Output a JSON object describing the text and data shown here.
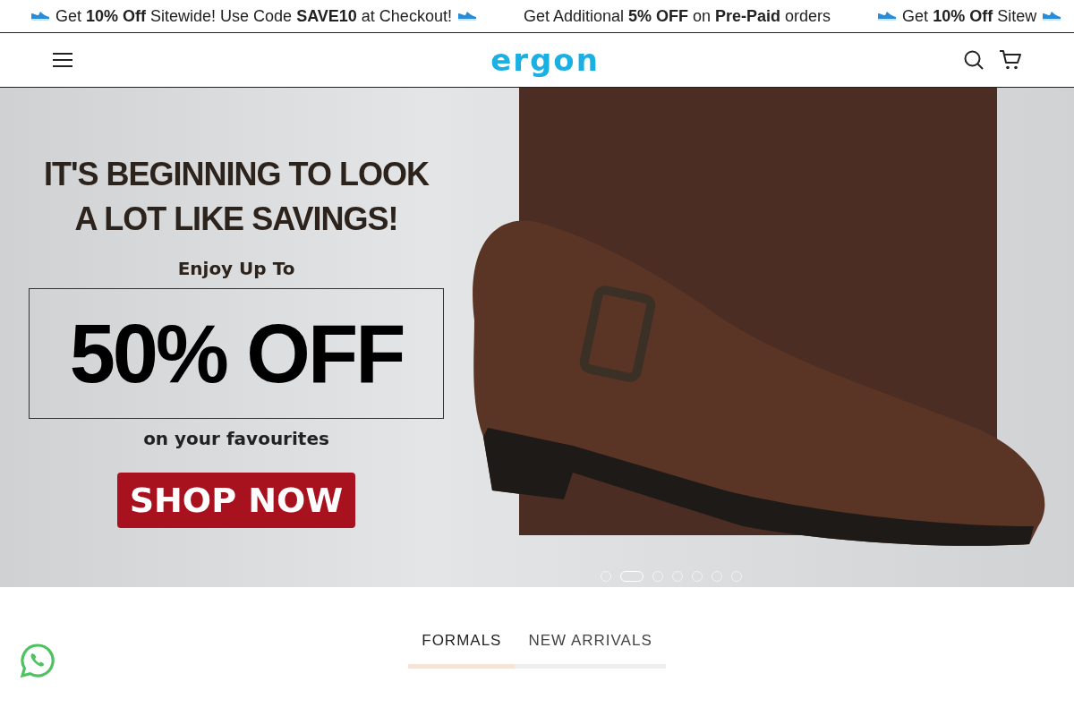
{
  "announcement_bar": {
    "messages": [
      {
        "text": "Get **10% Off** Sitewide! Use Code **SAVE10** at Checkout!",
        "shoe_icons": true
      },
      {
        "text": "Get Additional **5% OFF** on **Pre-Paid** orders",
        "shoe_icons": false
      },
      {
        "text": "Get **10% Off** Sitew",
        "shoe_icons": true
      }
    ]
  },
  "header": {
    "logo": "ergon"
  },
  "hero": {
    "headline": [
      "IT'S BEGINNING TO LOOK",
      "A LOT LIKE SAVINGS!"
    ],
    "intro": "Enjoy Up To",
    "offer": "50% OFF",
    "note": "on your favourites",
    "button": "SHOP NOW",
    "slides": [
      {
        "selected": false
      },
      {
        "selected": true
      },
      {
        "selected": false
      },
      {
        "selected": false
      },
      {
        "selected": false
      },
      {
        "selected": false
      },
      {
        "selected": false
      }
    ]
  },
  "tabs": [
    {
      "label": "FORMALS",
      "selected": true
    },
    {
      "label": "NEW ARRIVALS",
      "selected": false
    }
  ]
}
